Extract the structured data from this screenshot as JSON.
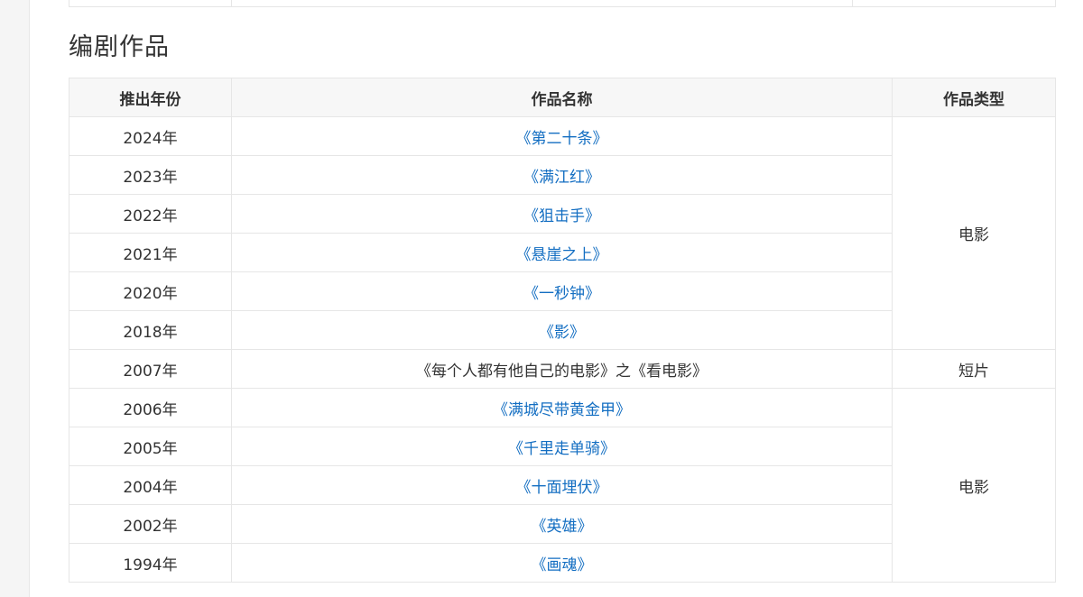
{
  "section": {
    "title": "编剧作品"
  },
  "table": {
    "headers": {
      "year": "推出年份",
      "name": "作品名称",
      "type": "作品类型"
    },
    "rows": [
      {
        "year": "2024年",
        "name": "《第二十条》",
        "linked": true
      },
      {
        "year": "2023年",
        "name": "《满江红》",
        "linked": true
      },
      {
        "year": "2022年",
        "name": "《狙击手》",
        "linked": true
      },
      {
        "year": "2021年",
        "name": "《悬崖之上》",
        "linked": true
      },
      {
        "year": "2020年",
        "name": "《一秒钟》",
        "linked": true
      },
      {
        "year": "2018年",
        "name": "《影》",
        "linked": true
      },
      {
        "year": "2007年",
        "name": "《每个人都有他自己的电影》之《看电影》",
        "linked": false
      },
      {
        "year": "2006年",
        "name": "《满城尽带黄金甲》",
        "linked": true
      },
      {
        "year": "2005年",
        "name": "《千里走单骑》",
        "linked": true
      },
      {
        "year": "2004年",
        "name": "《十面埋伏》",
        "linked": true
      },
      {
        "year": "2002年",
        "name": "《英雄》",
        "linked": true
      },
      {
        "year": "1994年",
        "name": "《画魂》",
        "linked": true
      }
    ],
    "type_groups": [
      {
        "label": "电影",
        "rowspan": 6
      },
      {
        "label": "短片",
        "rowspan": 1
      },
      {
        "label": "电影",
        "rowspan": 5
      }
    ]
  },
  "colors": {
    "link": "#136ec2",
    "text": "#333333",
    "border": "#e6e6e6",
    "header_bg": "#f7f7f7"
  }
}
